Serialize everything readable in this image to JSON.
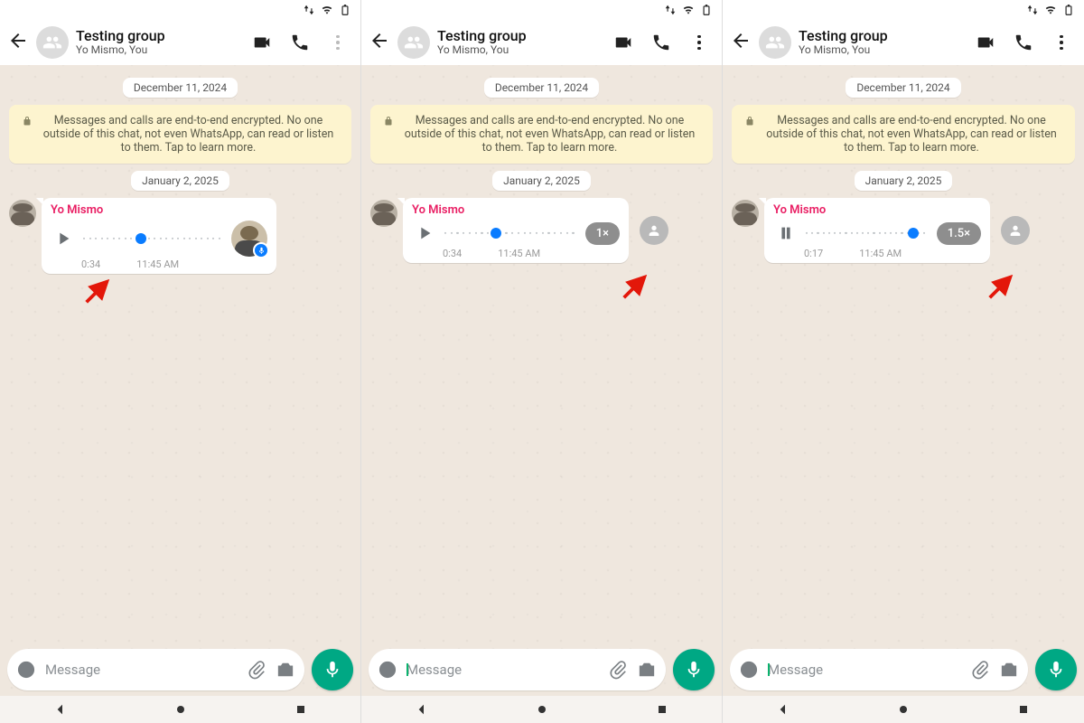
{
  "header": {
    "title": "Testing group",
    "subtitle": "Yo Mismo, You"
  },
  "chat": {
    "date1": "December 11, 2024",
    "encryption_notice": "Messages and calls are end-to-end encrypted. No one outside of this chat, not even WhatsApp, can read or listen to them. Tap to learn more.",
    "date2": "January 2, 2025",
    "sender": "Yo Mismo",
    "voice": {
      "duration_1": "0:34",
      "duration_2": "0:34",
      "duration_3": "0:17",
      "time": "11:45 AM",
      "speed_1x": "1×",
      "speed_15x": "1.5×"
    }
  },
  "composer": {
    "placeholder": "Message"
  }
}
